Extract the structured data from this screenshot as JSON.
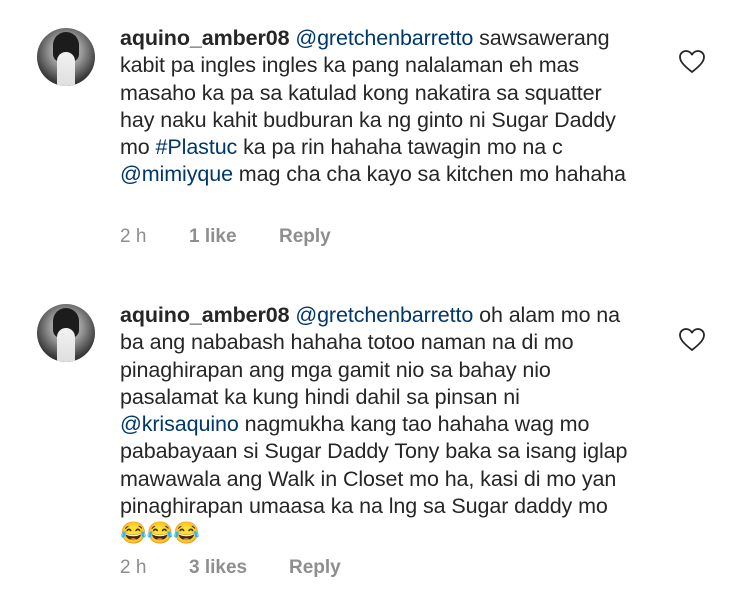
{
  "comments": [
    {
      "username": "aquino_amber08",
      "segments": [
        {
          "text": "@gretchenbarretto",
          "type": "mention"
        },
        {
          "text": " sawsawerang kabit pa ingles ingles ka pang nalalaman eh mas masaho ka pa sa katulad kong nakatira sa squatter hay naku kahit budburan ka ng ginto ni Sugar Daddy mo ",
          "type": "text"
        },
        {
          "text": "#Plastuc",
          "type": "mention"
        },
        {
          "text": " ka pa rin hahaha tawagin mo na c ",
          "type": "text"
        },
        {
          "text": "@mimiyque",
          "type": "mention"
        },
        {
          "text": " mag cha cha kayo sa kitchen mo hahaha",
          "type": "text"
        }
      ],
      "time": "2 h",
      "likes": "1 like",
      "reply": "Reply"
    },
    {
      "username": "aquino_amber08",
      "segments": [
        {
          "text": "@gretchenbarretto",
          "type": "mention"
        },
        {
          "text": " oh alam mo na ba ang nababash hahaha totoo naman na di mo pinaghirapan ang mga gamit nio sa bahay nio pasalamat ka kung hindi dahil sa pinsan ni ",
          "type": "text"
        },
        {
          "text": "@krisaquino",
          "type": "mention"
        },
        {
          "text": " nagmukha kang tao hahaha wag mo pababayaan si Sugar Daddy Tony baka sa isang iglap mawawala ang Walk in Closet mo ha, kasi di mo yan pinaghirapan umaasa ka na lng sa Sugar daddy mo ",
          "type": "text"
        },
        {
          "text": "😂😂😂",
          "type": "emoji"
        }
      ],
      "time": "2 h",
      "likes": "3 likes",
      "reply": "Reply"
    }
  ]
}
